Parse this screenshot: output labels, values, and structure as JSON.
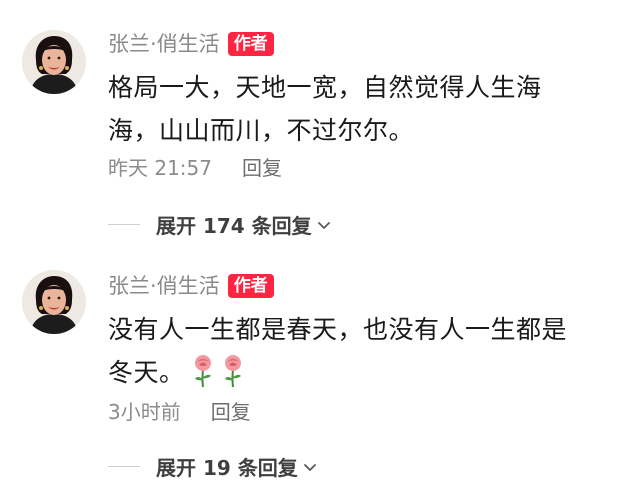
{
  "comments": [
    {
      "author": "张兰·俏生活",
      "badge": "作者",
      "content_lines": [
        "格局一大，天地一宽，自然觉得人生海",
        "海，山山而川，不过尔尔。"
      ],
      "time": "昨天 21:57",
      "reply_label": "回复",
      "expand_label": "展开 174 条回复"
    },
    {
      "author": "张兰·俏生活",
      "badge": "作者",
      "content_lines": [
        "没有人一生都是春天，也没有人一生都是",
        "冬天。"
      ],
      "emojis": [
        "rose-emoji",
        "rose-emoji"
      ],
      "time": "3小时前",
      "reply_label": "回复",
      "expand_label": "展开 19 条回复"
    }
  ],
  "colors": {
    "badge_bg": "#ff2442",
    "meta_text": "#8c8c8c"
  },
  "icons": {
    "avatar": "avatar",
    "expand": "chevron-down-icon",
    "emoji": "rose-emoji"
  }
}
